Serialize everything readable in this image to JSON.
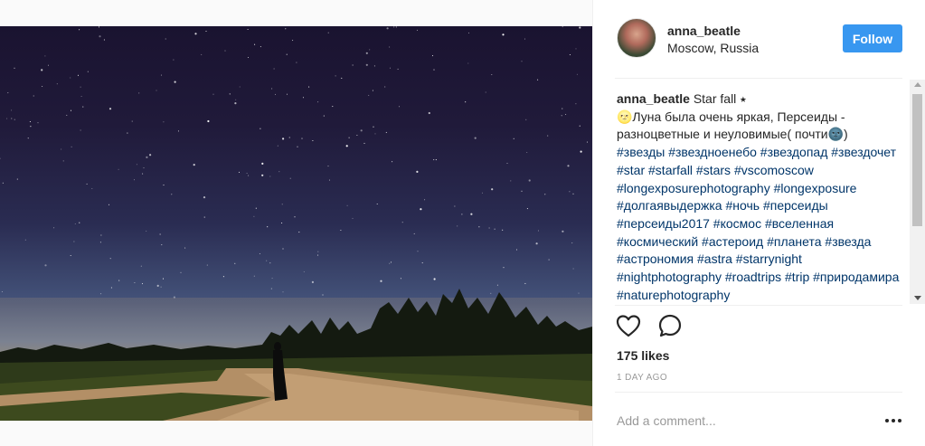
{
  "post": {
    "username": "anna_beatle",
    "location": "Moscow, Russia",
    "follow_label": "Follow",
    "photo_icon": "photo-night-sky",
    "caption": {
      "username": "anna_beatle",
      "text": " Star fall ⭑\n🌝Луна была очень яркая, Персеиды - разноцветные и неуловимые( почти🌚)\n",
      "hashtags": "#звезды #звездноенебо #звездопад #звездочет #star #starfall #stars #vscomoscow #longexposurephotography #longexposure #долгаявыдержка #ночь #персеиды #персеиды2017 #космос #вселенная #космический #астероид #планета #звезда #астрономия #astra #starrynight #nightphotography #roadtrips #trip #природамира #naturephotography"
    },
    "likes": "175 likes",
    "time_ago": "1 DAY AGO",
    "comment_placeholder": "Add a comment...",
    "icons": {
      "like": "heart-icon",
      "comment": "comment-icon",
      "more": "more-options-icon"
    },
    "colors": {
      "follow_bg": "#3897f0",
      "hashtag": "#003569",
      "text": "#262626",
      "muted": "#999999"
    }
  }
}
